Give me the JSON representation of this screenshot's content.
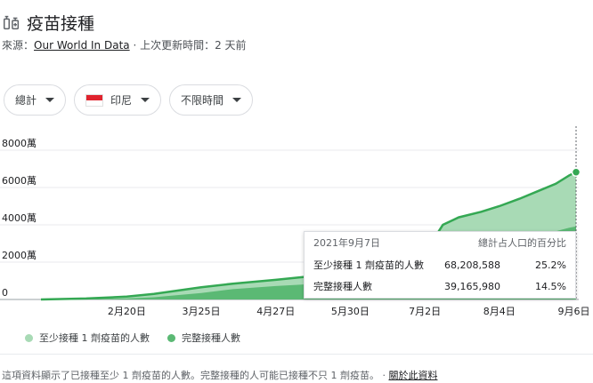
{
  "header": {
    "title": "疫苗接種",
    "source_prefix": "來源：",
    "source_link": "Our World In Data",
    "updated": " · 上次更新時間：2 天前"
  },
  "filters": {
    "metric": "總計",
    "country": "印尼",
    "range": "不限時間"
  },
  "colors": {
    "at_least_one": "#a8dab5",
    "fully": "#5bb974",
    "line": "#34a853"
  },
  "tooltip": {
    "date": "2021年9月7日",
    "col_total": "總計",
    "col_pct": "占人口的百分比",
    "rows": [
      {
        "label": "至少接種 1 劑疫苗的人數",
        "total": "68,208,588",
        "pct": "25.2%"
      },
      {
        "label": "完整接種人數",
        "total": "39,165,980",
        "pct": "14.5%"
      }
    ]
  },
  "legend": {
    "at_least_one": "至少接種 1 劑疫苗的人數",
    "fully": "完整接種人數"
  },
  "footnote": {
    "text": "這項資料顯示了已接種至少 1 劑疫苗的人數。完整接種的人可能已接種不只 1 劑疫苗。 · ",
    "link": "關於此資料"
  },
  "chart_data": {
    "type": "area",
    "x_tick_labels": [
      "2月20日",
      "3月25日",
      "4月27日",
      "5月30日",
      "7月2日",
      "8月4日",
      "9月6日"
    ],
    "y_tick_labels": [
      "0",
      "2000萬",
      "4000萬",
      "6000萬",
      "8000萬"
    ],
    "ylim": [
      0,
      90000000
    ],
    "grid": true,
    "x_ticks": [
      38,
      71,
      104,
      137,
      170,
      203,
      236
    ],
    "series": [
      {
        "name": "至少接種 1 劑疫苗的人數",
        "x": [
          0,
          20,
          38,
          50,
          71,
          85,
          104,
          120,
          137,
          150,
          165,
          170,
          178,
          185,
          195,
          203,
          212,
          220,
          228,
          234,
          237
        ],
        "values": [
          0,
          500000,
          1500000,
          3000000,
          6500000,
          8500000,
          10500000,
          12500000,
          14500000,
          16500000,
          22000000,
          25000000,
          40000000,
          44000000,
          47000000,
          50000000,
          54000000,
          58000000,
          62000000,
          66500000,
          68208588
        ]
      },
      {
        "name": "完整接種人數",
        "x": [
          0,
          20,
          38,
          50,
          71,
          85,
          104,
          120,
          137,
          150,
          165,
          170,
          178,
          185,
          195,
          203,
          212,
          220,
          228,
          234,
          237
        ],
        "values": [
          0,
          100000,
          500000,
          1200000,
          3500000,
          5500000,
          7200000,
          8300000,
          9500000,
          11000000,
          13500000,
          15500000,
          18500000,
          21000000,
          25000000,
          28000000,
          31000000,
          34000000,
          36500000,
          38500000,
          39165980
        ]
      }
    ]
  }
}
